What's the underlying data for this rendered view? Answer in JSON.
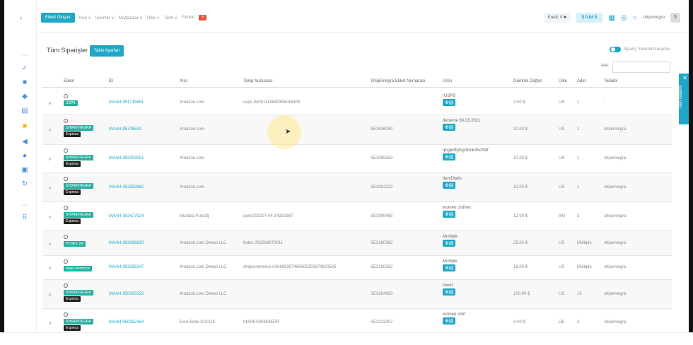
{
  "filters": {
    "active": "Etiket Oluştur",
    "items": [
      "Kod ∨",
      "İşlemler ∨",
      "Mağazalar ∨",
      "Ülke ∨",
      "Tarih ∨",
      "Filtrele"
    ],
    "count": "5"
  },
  "topbar": {
    "credit": "Kredi: 0 ■",
    "money": "$ 0,84 $",
    "user": "shipentegra",
    "avatar": "S"
  },
  "page": {
    "title": "Tüm Siparişler",
    "table_btn": "Tablo Ayarları",
    "toggle_label": "Sipariş Senkronizasyonu",
    "search_label": "Ara:",
    "search_value": ""
  },
  "columns": [
    "Etiket",
    "ID",
    "Alıcı",
    "Takip Numarası",
    "ShipEntegra Etiket Numarası",
    "Ürün",
    "Gümrük Değeri",
    "Ülke",
    "Adet",
    "Tedarik"
  ],
  "rows": [
    {
      "tag": "USPS",
      "tag2": "",
      "id": "MAAH-951715851",
      "buyer": "Amazon.com",
      "tracking": "usps-94001118840355016305",
      "label": "",
      "item": "rUSPS",
      "value": "3.00 $",
      "country": "US",
      "qty": "1",
      "supplier": "-"
    },
    {
      "tag": "SHIPENTEGRA",
      "tag2": "Express",
      "id": "MAAH-95705530",
      "buyer": "Amazon.com",
      "tracking": "",
      "label": "SE2636080",
      "item": "deneme 30.03.2021",
      "value": "10.00 $",
      "country": "US",
      "qty": "1",
      "supplier": "shipentegra"
    },
    {
      "tag": "SHIPENTEGRA",
      "tag2": "Express",
      "id": "MAAH-952003051",
      "buyer": "Amazon.com",
      "tracking": "",
      "label": "SE3089553",
      "item": "qhgjkdfgfsgrlkmkdhcfhdf",
      "value": "10.00 $",
      "country": "US",
      "qty": "1",
      "supplier": "shipentegra"
    },
    {
      "tag": "SHIPENTEGRA",
      "tag2": "Express",
      "id": "MAAH-953592982",
      "buyer": "Amazon.com",
      "tracking": "",
      "label": "SE3092223",
      "item": "ItemDtails",
      "value": "10.00 $",
      "country": "US",
      "qty": "1",
      "supplier": "shipentegra"
    },
    {
      "tag": "SHIPENTEGRA",
      "tag2": "Express",
      "id": "MAAH-953427524",
      "buyer": "Mustafa Kılıcoğ",
      "tracking": "upsn203207-04-14320987",
      "label": "SE3096455",
      "item": "women clothes",
      "value": "12.00 $",
      "country": "SM",
      "qty": "3",
      "supplier": "shipentegra"
    },
    {
      "tag": "PTDEX JM",
      "tag2": "",
      "id": "MAAH-953086830",
      "buyer": "Amazon.com Deluel LLC",
      "tracking": "fedex:783268870011",
      "label": "SE3180362",
      "item": "Multiple",
      "value": "25.00 $",
      "country": "US",
      "qty": "Multiple",
      "supplier": "shipentegra"
    },
    {
      "tag": "shipCommerce",
      "tag2": "",
      "id": "MAAH-953085247",
      "buyer": "Amazon.com Deluel LLC",
      "tracking": "shipcommerce:A20609397485605350674920505",
      "label": "SE3180552",
      "item": "Multiple",
      "value": "18.00 $",
      "country": "US",
      "qty": "Multiple",
      "supplier": "shipentegra"
    },
    {
      "tag": "SHIPENTEGRA",
      "tag2": "Express",
      "id": "MAAH-950005322",
      "buyer": "Amazon.com Deluel LLC",
      "tracking": "",
      "label": "SE3264900",
      "item": "towel",
      "value": "100.00 $",
      "country": "US",
      "qty": "10",
      "supplier": "shipentegra"
    },
    {
      "tag": "SHIPENTEGRA",
      "tag2": "Express",
      "id": "MAAH-950052164",
      "buyer": "Esra Betul KUCUK",
      "tracking": "trk00670808095TR",
      "label": "SE3213307",
      "item": "women shirt",
      "value": "4.00 $",
      "country": "DE",
      "qty": "2",
      "supplier": "shipentegra"
    }
  ],
  "side_tab": "Geri Bildirim"
}
